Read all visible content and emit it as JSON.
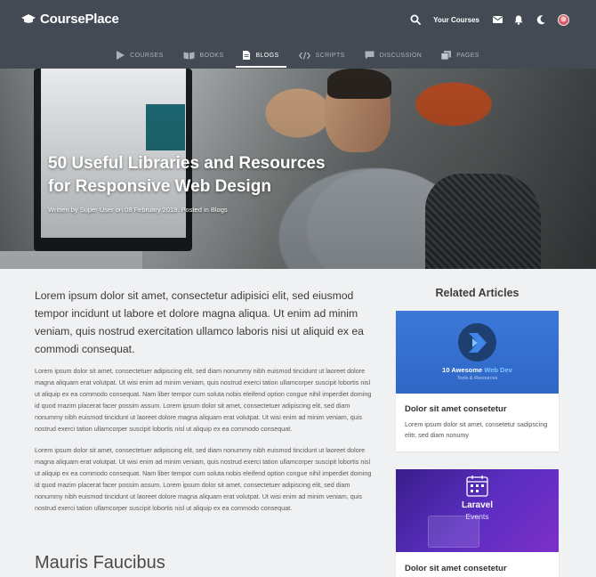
{
  "header": {
    "brand": "CoursePlace",
    "your_courses": "Your Courses"
  },
  "nav": {
    "items": [
      {
        "label": "COURSES",
        "icon": "play-icon"
      },
      {
        "label": "BOOKS",
        "icon": "book-icon"
      },
      {
        "label": "BLOGS",
        "icon": "document-icon",
        "active": true
      },
      {
        "label": "SCRIPTS",
        "icon": "code-icon"
      },
      {
        "label": "DISCUSSION",
        "icon": "chat-icon"
      },
      {
        "label": "PAGES",
        "icon": "pages-icon"
      }
    ]
  },
  "hero": {
    "title_line1": "50 Useful Libraries and Resources",
    "title_line2": "for Responsive Web Design",
    "meta": "Written by Super User on 08 February 2019. Posted in Blogs"
  },
  "article": {
    "lead": "Lorem ipsum dolor sit amet, consectetur adipisici elit, sed eiusmod tempor incidunt ut labore et dolore magna aliqua. Ut enim ad minim veniam, quis nostrud exercitation ullamco laboris nisi ut aliquid ex ea commodi consequat.",
    "para1": "Lorem ipsum dolor sit amet, consectetuer adipiscing elit, sed diam nonummy nibh euismod tincidunt ut laoreet dolore magna aliquam erat volutpat. Ut wisi enim ad minim veniam, quis nostrud exerci tation ullamcorper suscipit lobortis nisl ut aliquip ex ea commodo consequat. Nam liber tempor cum soluta nobis eleifend option congue nihil imperdiet doming id quod mazim placerat facer possim assum. Lorem ipsum dolor sit amet, consectetuer adipiscing elit, sed diam nonummy nibh euismod tincidunt ut laoreet dolore magna aliquam erat volutpat. Ut wisi enim ad minim veniam, quis nostrud exerci tation ullamcorper suscipit lobortis nisl ut aliquip ex ea commodo consequat.",
    "para2": "Lorem ipsum dolor sit amet, consectetuer adipiscing elit, sed diam nonummy nibh euismod tincidunt ut laoreet dolore magna aliquam erat volutpat. Ut wisi enim ad minim veniam, quis nostrud exerci tation ullamcorper suscipit lobortis nisl ut aliquip ex ea commodo consequat. Nam liber tempor cum soluta nobis eleifend option congue nihil imperdiet doming id quod mazim placerat facer possim assum. Lorem ipsum dolor sit amet, consectetuer adipiscing elit, sed diam nonummy nibh euismod tincidunt ut laoreet dolore magna aliquam erat volutpat. Ut wisi enim ad minim veniam, quis nostrud exerci tation ullamcorper suscipit lobortis nisl ut aliquip ex ea commodo consequat.",
    "subheading": "Mauris Faucibus"
  },
  "sidebar": {
    "title": "Related Articles",
    "cards": [
      {
        "thumb_line1_pre": "10 Awesome ",
        "thumb_line1_hl": "Web Dev",
        "thumb_line2": "Tools & Resources",
        "title": "Dolor sit amet consetetur",
        "text": "Lorem ipsum dolor sit amet, consetetur sadipscing elitr, sed diam nonumy"
      },
      {
        "thumb_line1": "Laravel",
        "thumb_line2": "Events",
        "title": "Dolor sit amet consetetur"
      }
    ]
  }
}
